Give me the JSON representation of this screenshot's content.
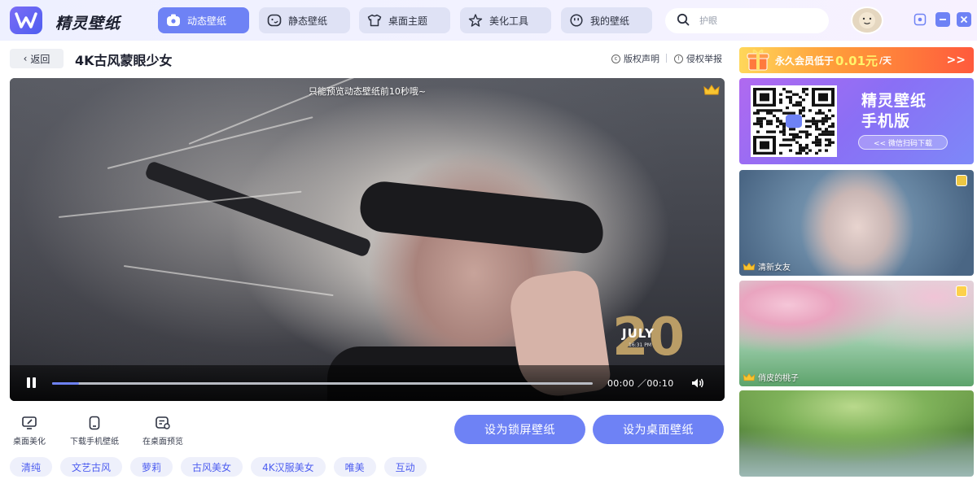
{
  "app": {
    "name": "精灵壁纸"
  },
  "nav": {
    "tabs": [
      {
        "label": "动态壁纸",
        "icon": "video-icon",
        "active": true
      },
      {
        "label": "静态壁纸",
        "icon": "image-face-icon",
        "active": false
      },
      {
        "label": "桌面主题",
        "icon": "shirt-icon",
        "active": false
      },
      {
        "label": "美化工具",
        "icon": "sparkle-star-icon",
        "active": false
      },
      {
        "label": "我的壁纸",
        "icon": "smile-icon",
        "active": false
      }
    ]
  },
  "search": {
    "placeholder": "护眼",
    "value": ""
  },
  "window_controls": [
    "eye-icon",
    "minimize-icon",
    "close-icon"
  ],
  "page": {
    "back_label": "返回",
    "title": "4K古风蒙眼少女",
    "copyright_label": "版权声明",
    "report_label": "侵权举报"
  },
  "player": {
    "preview_notice": "只能预览动态壁纸前10秒哦~",
    "clock_day": "20",
    "clock_month": "JULY",
    "clock_time": "16:31 PM",
    "current_time": "00:00",
    "separator": "／",
    "duration": "00:10",
    "progress": 0.05
  },
  "tools": [
    {
      "label": "桌面美化",
      "icon": "desktop-brush-icon"
    },
    {
      "label": "下载手机壁纸",
      "icon": "phone-icon"
    },
    {
      "label": "在桌面预览",
      "icon": "desktop-preview-icon"
    }
  ],
  "actions": {
    "set_lock": "设为锁屏壁纸",
    "set_desktop": "设为桌面壁纸"
  },
  "tags": [
    "清纯",
    "文艺古风",
    "萝莉",
    "古风美女",
    "4K汉服美女",
    "唯美",
    "互动"
  ],
  "sidebar": {
    "vip": {
      "text": "永久会员低于",
      "price": "0.01元",
      "unit": "/天",
      "arrow": ">>"
    },
    "mobile": {
      "title_line1": "精灵壁纸",
      "title_line2": "手机版",
      "scan": "<< 微信扫码下载"
    },
    "thumbs": [
      {
        "label": "清新女友"
      },
      {
        "label": "俏皮的桃子"
      },
      {
        "label": ""
      }
    ]
  },
  "colors": {
    "accent": "#6e82f5",
    "tag_text": "#4e5ef0",
    "vip_price": "#fff36b"
  }
}
